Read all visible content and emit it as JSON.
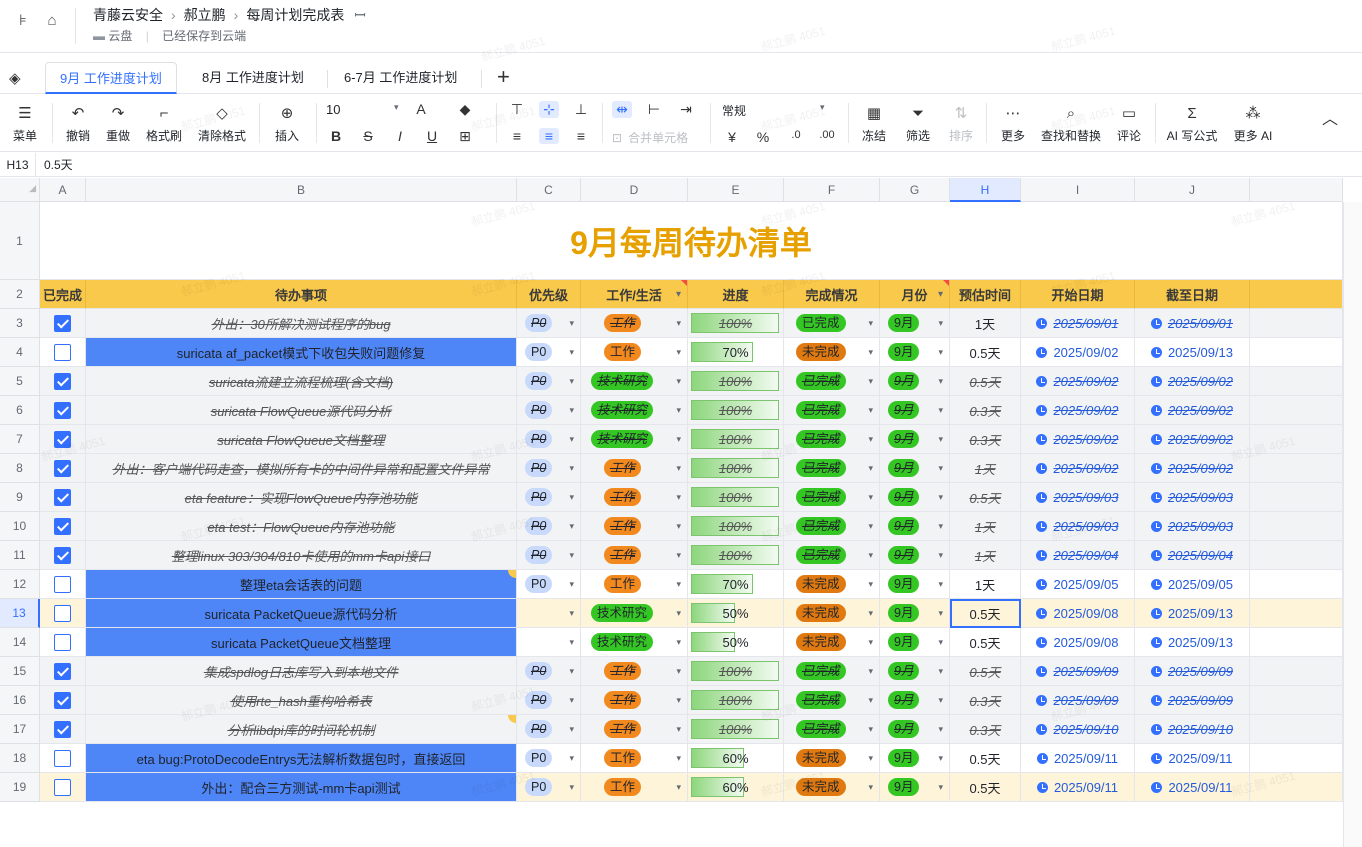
{
  "header": {
    "breadcrumb": [
      "青藤云安全",
      "郝立鹏",
      "每周计划完成表"
    ],
    "location": "云盘",
    "save_status": "已经保存到云端"
  },
  "tabs": [
    "9月 工作进度计划",
    "8月 工作进度计划",
    "6-7月 工作进度计划"
  ],
  "toolbar": {
    "menu": "菜单",
    "undo": "撤销",
    "redo": "重做",
    "format_painter": "格式刷",
    "clear_format": "清除格式",
    "insert": "插入",
    "font_size": "10",
    "merge": "合并单元格",
    "number_format": "常规",
    "freeze": "冻结",
    "filter": "筛选",
    "sort": "排序",
    "more": "更多",
    "find_replace": "查找和替换",
    "comment": "评论",
    "ai_formula": "AI 写公式",
    "more_ai": "更多 AI",
    "currency": "¥",
    "percent": "%"
  },
  "formula_bar": {
    "cell_ref": "H13",
    "value": "0.5天"
  },
  "columns": [
    "A",
    "B",
    "C",
    "D",
    "E",
    "F",
    "G",
    "H",
    "I",
    "J"
  ],
  "sheet_title": "9月每周待办清单",
  "table_headers": [
    "已完成",
    "待办事项",
    "优先级",
    "工作/生活",
    "进度",
    "完成情况",
    "月份",
    "预估时间",
    "开始日期",
    "截至日期"
  ],
  "rows": [
    {
      "n": "3",
      "done": true,
      "task": "外出：30所解决测试程序的bug",
      "prio": "P0",
      "type": "工作",
      "prog": "100%",
      "status": "已完成",
      "month": "9月",
      "est": "1天",
      "start": "2025/09/01",
      "end": "2025/09/01"
    },
    {
      "n": "4",
      "done": false,
      "task": "suricata af_packet模式下收包失败问题修复",
      "prio": "P0",
      "type": "工作",
      "prog": "70%",
      "status": "未完成",
      "month": "9月",
      "est": "0.5天",
      "start": "2025/09/02",
      "end": "2025/09/13"
    },
    {
      "n": "5",
      "done": true,
      "task": "suricata流建立流程梳理(含文档)",
      "prio": "P0",
      "type": "技术研究",
      "prog": "100%",
      "status": "已完成",
      "month": "9月",
      "est": "0.5天",
      "start": "2025/09/02",
      "end": "2025/09/02"
    },
    {
      "n": "6",
      "done": true,
      "task": "suricata FlowQueue源代码分析",
      "prio": "P0",
      "type": "技术研究",
      "prog": "100%",
      "status": "已完成",
      "month": "9月",
      "est": "0.3天",
      "start": "2025/09/02",
      "end": "2025/09/02"
    },
    {
      "n": "7",
      "done": true,
      "task": "suricata FlowQueue文档整理",
      "prio": "P0",
      "type": "技术研究",
      "prog": "100%",
      "status": "已完成",
      "month": "9月",
      "est": "0.3天",
      "start": "2025/09/02",
      "end": "2025/09/02"
    },
    {
      "n": "8",
      "done": true,
      "task": "外出：客户端代码走查，模拟所有卡的中间件异常和配置文件异常",
      "prio": "P0",
      "type": "工作",
      "prog": "100%",
      "status": "已完成",
      "month": "9月",
      "est": "1天",
      "start": "2025/09/02",
      "end": "2025/09/02"
    },
    {
      "n": "9",
      "done": true,
      "task": "eta feature：实现FlowQueue内存池功能",
      "prio": "P0",
      "type": "工作",
      "prog": "100%",
      "status": "已完成",
      "month": "9月",
      "est": "0.5天",
      "start": "2025/09/03",
      "end": "2025/09/03"
    },
    {
      "n": "10",
      "done": true,
      "task": "eta test：FlowQueue内存池功能",
      "prio": "P0",
      "type": "工作",
      "prog": "100%",
      "status": "已完成",
      "month": "9月",
      "est": "1天",
      "start": "2025/09/03",
      "end": "2025/09/03"
    },
    {
      "n": "11",
      "done": true,
      "task": "整理linux 303/304/810卡使用的mm卡api接口",
      "prio": "P0",
      "type": "工作",
      "prog": "100%",
      "status": "已完成",
      "month": "9月",
      "est": "1天",
      "start": "2025/09/04",
      "end": "2025/09/04"
    },
    {
      "n": "12",
      "done": false,
      "task": "整理eta会话表的问题",
      "prio": "P0",
      "type": "工作",
      "prog": "70%",
      "status": "未完成",
      "month": "9月",
      "est": "1天",
      "start": "2025/09/05",
      "end": "2025/09/05"
    },
    {
      "n": "13",
      "done": false,
      "task": "suricata PacketQueue源代码分析",
      "prio": "",
      "type": "技术研究",
      "prog": "50%",
      "status": "未完成",
      "month": "9月",
      "est": "0.5天",
      "start": "2025/09/08",
      "end": "2025/09/13"
    },
    {
      "n": "14",
      "done": false,
      "task": "suricata PacketQueue文档整理",
      "prio": "",
      "type": "技术研究",
      "prog": "50%",
      "status": "未完成",
      "month": "9月",
      "est": "0.5天",
      "start": "2025/09/08",
      "end": "2025/09/13"
    },
    {
      "n": "15",
      "done": true,
      "task": "集成spdlog日志库写入到本地文件",
      "prio": "P0",
      "type": "工作",
      "prog": "100%",
      "status": "已完成",
      "month": "9月",
      "est": "0.5天",
      "start": "2025/09/09",
      "end": "2025/09/09"
    },
    {
      "n": "16",
      "done": true,
      "task": "使用rte_hash重构哈希表",
      "prio": "P0",
      "type": "工作",
      "prog": "100%",
      "status": "已完成",
      "month": "9月",
      "est": "0.3天",
      "start": "2025/09/09",
      "end": "2025/09/09"
    },
    {
      "n": "17",
      "done": true,
      "task": "分析libdpi库的时间轮机制",
      "prio": "P0",
      "type": "工作",
      "prog": "100%",
      "status": "已完成",
      "month": "9月",
      "est": "0.3天",
      "start": "2025/09/10",
      "end": "2025/09/10"
    },
    {
      "n": "18",
      "done": false,
      "task": "eta bug:ProtoDecodeEntrys无法解析数据包时，直接返回",
      "prio": "P0",
      "type": "工作",
      "prog": "60%",
      "status": "未完成",
      "month": "9月",
      "est": "0.5天",
      "start": "2025/09/11",
      "end": "2025/09/11"
    },
    {
      "n": "19",
      "done": false,
      "task": "外出：配合三方测试-mm卡api测试",
      "prio": "P0",
      "type": "工作",
      "prog": "60%",
      "status": "未完成",
      "month": "9月",
      "est": "0.5天",
      "start": "2025/09/11",
      "end": "2025/09/11"
    }
  ],
  "watermark": "郝立鹏 4051"
}
